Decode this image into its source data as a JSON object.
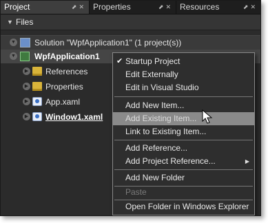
{
  "tabs": [
    {
      "label": "Project",
      "active": true
    },
    {
      "label": "Properties",
      "active": false
    },
    {
      "label": "Resources",
      "active": false
    }
  ],
  "panel": {
    "header": "Files"
  },
  "tree": {
    "solution": "Solution \"WpfApplication1\" (1 project(s))",
    "project": "WpfApplication1",
    "items": [
      {
        "label": "References",
        "icon": "folder-icon"
      },
      {
        "label": "Properties",
        "icon": "folder-icon"
      },
      {
        "label": "App.xaml",
        "icon": "xaml-file-icon"
      },
      {
        "label": "Window1.xaml",
        "icon": "xaml-file-icon"
      }
    ]
  },
  "context_menu": {
    "items": [
      {
        "label": "Startup Project",
        "checked": true
      },
      {
        "label": "Edit Externally"
      },
      {
        "label": "Edit in Visual Studio"
      },
      {
        "label": "Add New Item..."
      },
      {
        "label": "Add Existing Item...",
        "disabled": true,
        "highlighted": true
      },
      {
        "label": "Link to Existing Item..."
      },
      {
        "label": "Add Reference..."
      },
      {
        "label": "Add Project Reference...",
        "submenu": true
      },
      {
        "label": "Add New Folder"
      },
      {
        "label": "Paste",
        "disabled": true
      },
      {
        "label": "Open Folder in Windows Explorer"
      }
    ]
  },
  "colors": {
    "panel_bg": "#2b2b2b",
    "menu_bg": "#2e2e2e",
    "highlight": "#8a8a8a",
    "folder": "#d9b43a"
  }
}
